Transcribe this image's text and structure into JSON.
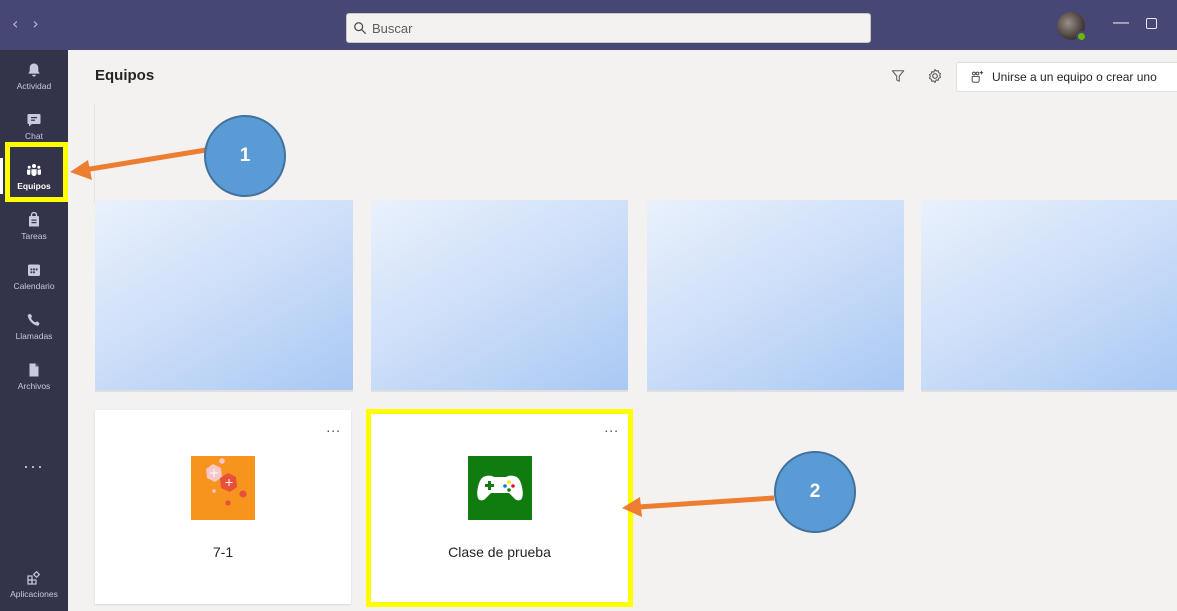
{
  "titlebar": {
    "back_glyph": "‹",
    "forward_glyph": "›",
    "search_placeholder": "Buscar",
    "minimize_glyph": "—"
  },
  "rail": {
    "items": [
      {
        "label": "Actividad",
        "icon": "bell-icon"
      },
      {
        "label": "Chat",
        "icon": "chat-icon"
      },
      {
        "label": "Equipos",
        "icon": "teams-icon",
        "active": true
      },
      {
        "label": "Tareas",
        "icon": "assignments-icon"
      },
      {
        "label": "Calendario",
        "icon": "calendar-icon"
      },
      {
        "label": "Llamadas",
        "icon": "phone-icon"
      },
      {
        "label": "Archivos",
        "icon": "file-icon"
      }
    ],
    "more_label": "...",
    "apps_label": "Aplicaciones"
  },
  "header": {
    "title": "Equipos",
    "join_label": "Unirse a un equipo o crear uno"
  },
  "teams": [
    {
      "name": "7-1",
      "more": "...",
      "tile_color": "#f7941d"
    },
    {
      "name": "Clase de prueba",
      "more": "...",
      "tile_color": "#107c10"
    }
  ],
  "annotations": {
    "callout_1": "1",
    "callout_2": "2",
    "arrow_color": "#ed7d31",
    "highlight_color": "#ffff00"
  },
  "colors": {
    "titlebar": "#464775",
    "rail": "#33344a",
    "background": "#f3f2f1"
  }
}
